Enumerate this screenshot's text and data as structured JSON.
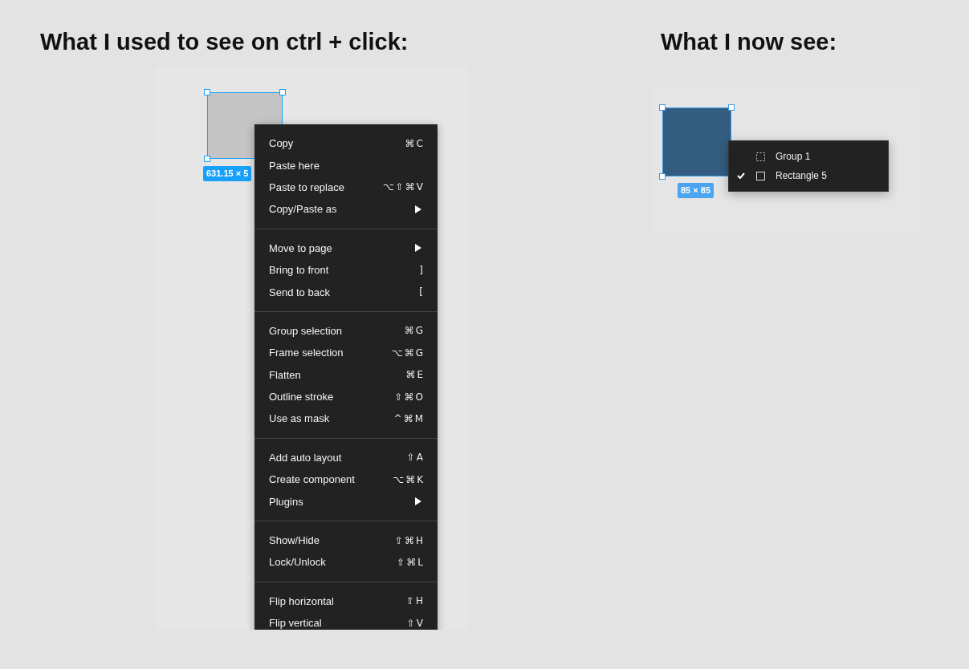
{
  "left_panel": {
    "heading": "What I used to see on ctrl + click:",
    "selection_size": "631.15 × 5",
    "context_menu": {
      "sections": [
        {
          "items": [
            {
              "label": "Copy",
              "kind": "shortcut",
              "shortcut": "⌘C"
            },
            {
              "label": "Paste here",
              "kind": "plain"
            },
            {
              "label": "Paste to replace",
              "kind": "shortcut",
              "shortcut": "⌥⇧⌘V"
            },
            {
              "label": "Copy/Paste as",
              "kind": "submenu"
            }
          ]
        },
        {
          "items": [
            {
              "label": "Move to page",
              "kind": "submenu"
            },
            {
              "label": "Bring to front",
              "kind": "shortcut",
              "shortcut": "]"
            },
            {
              "label": "Send to back",
              "kind": "shortcut",
              "shortcut": "["
            }
          ]
        },
        {
          "items": [
            {
              "label": "Group selection",
              "kind": "shortcut",
              "shortcut": "⌘G"
            },
            {
              "label": "Frame selection",
              "kind": "shortcut",
              "shortcut": "⌥⌘G"
            },
            {
              "label": "Flatten",
              "kind": "shortcut",
              "shortcut": "⌘E"
            },
            {
              "label": "Outline stroke",
              "kind": "shortcut",
              "shortcut": "⇧⌘O"
            },
            {
              "label": "Use as mask",
              "kind": "shortcut",
              "shortcut": "^⌘M"
            }
          ]
        },
        {
          "items": [
            {
              "label": "Add auto layout",
              "kind": "shortcut",
              "shortcut": "⇧A"
            },
            {
              "label": "Create component",
              "kind": "shortcut",
              "shortcut": "⌥⌘K"
            },
            {
              "label": "Plugins",
              "kind": "submenu"
            }
          ]
        },
        {
          "items": [
            {
              "label": "Show/Hide",
              "kind": "shortcut",
              "shortcut": "⇧⌘H"
            },
            {
              "label": "Lock/Unlock",
              "kind": "shortcut",
              "shortcut": "⇧⌘L"
            }
          ]
        },
        {
          "items": [
            {
              "label": "Flip horizontal",
              "kind": "shortcut",
              "shortcut": "⇧H"
            },
            {
              "label": "Flip vertical",
              "kind": "shortcut",
              "shortcut": "⇧V"
            }
          ]
        }
      ]
    }
  },
  "right_panel": {
    "heading": "What I now see:",
    "selection_size": "85 × 85",
    "layer_menu": {
      "items": [
        {
          "label": "Group 1",
          "kind": "group",
          "selected": false
        },
        {
          "label": "Rectangle 5",
          "kind": "rectangle",
          "selected": true
        }
      ]
    }
  }
}
